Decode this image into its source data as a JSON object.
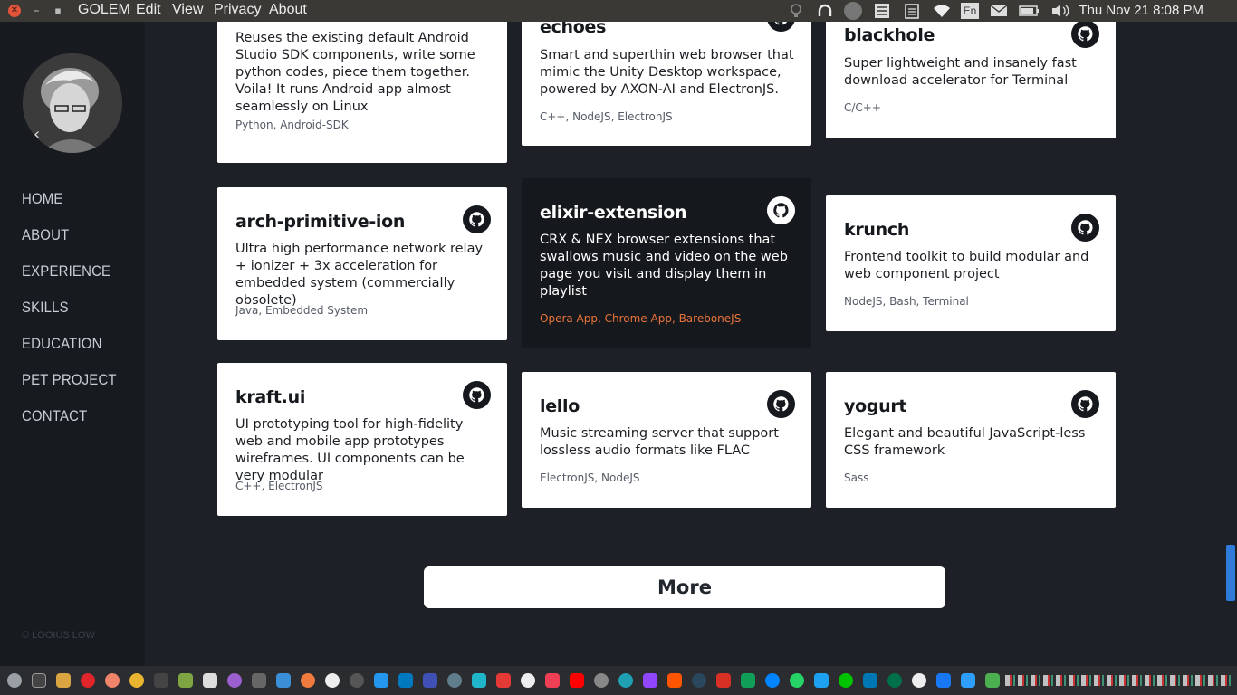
{
  "topbar": {
    "app_name": "GOLEM",
    "menus": [
      "Edit",
      "View",
      "Privacy",
      "About"
    ],
    "keyboard_layout": "En",
    "clock": "Thu Nov 21  8:08 PM"
  },
  "sidebar": {
    "nav": [
      "HOME",
      "ABOUT",
      "EXPERIENCE",
      "SKILLS",
      "EDUCATION",
      "PET PROJECT",
      "CONTACT"
    ],
    "copyright": "© LOOIUS LOW"
  },
  "projects": [
    {
      "title": "",
      "desc": "Reuses the existing default Android Studio SDK components, write some python codes, piece them together. Voila! It runs Android app almost seamlessly on Linux",
      "tags": "Python, Android-SDK"
    },
    {
      "title": "echoes",
      "desc": "Smart and superthin web browser that mimic the Unity Desktop workspace, powered by AXON-AI and ElectronJS.",
      "tags": "C++, NodeJS, ElectronJS"
    },
    {
      "title": "blackhole",
      "desc": "Super lightweight and insanely fast download accelerator for Terminal",
      "tags": "C/C++"
    },
    {
      "title": "arch-primitive-ion",
      "desc": "Ultra high performance network relay + ionizer + 3x acceleration for embedded system (commercially obsolete)",
      "tags": "Java, Embedded System"
    },
    {
      "title": "elixir-extension",
      "desc": "CRX & NEX browser extensions that swallows music and video on the web page you visit and display them in playlist",
      "tags": "Opera App, Chrome App, BareboneJS"
    },
    {
      "title": "krunch",
      "desc": "Frontend toolkit to build modular and web component project",
      "tags": "NodeJS, Bash, Terminal"
    },
    {
      "title": "kraft.ui",
      "desc": "UI prototyping tool for high-fidelity web and mobile app prototypes wireframes. UI components can be very modular",
      "tags": "C++, ElectronJS"
    },
    {
      "title": "lello",
      "desc": "Music streaming server that support lossless audio formats like FLAC",
      "tags": "ElectronJS, NodeJS"
    },
    {
      "title": "yogurt",
      "desc": "Elegant and beautiful JavaScript-less CSS framework",
      "tags": "Sass"
    }
  ],
  "more_label": "More",
  "colors": {
    "background": "#1d2027",
    "sidebar": "#171a1f",
    "card": "#ffffff",
    "card_dark": "#15181c",
    "accent_tags": "#e8743b",
    "scrollbar": "#2f7bd9"
  },
  "icons": {
    "card_link": "github-icon",
    "tray": [
      "lightbulb-icon",
      "headset-icon",
      "avatar-icon",
      "list-icon",
      "clipboard-icon",
      "wifi-icon",
      "keyboard-icon",
      "mail-icon",
      "battery-icon",
      "volume-icon"
    ]
  }
}
